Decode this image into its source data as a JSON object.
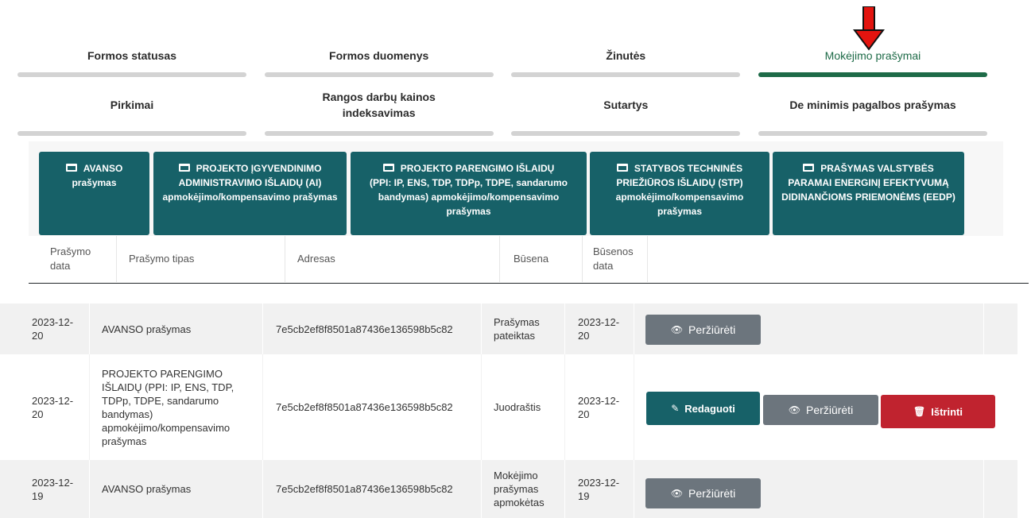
{
  "tabs_row1": [
    {
      "label": "Formos statusas"
    },
    {
      "label": "Formos duomenys"
    },
    {
      "label": "Žinutės"
    },
    {
      "label": "Mokėjimo prašymai"
    }
  ],
  "tabs_row2": [
    {
      "label": "Pirkimai"
    },
    {
      "label": "Rangos darbų kainos indeksavimas"
    },
    {
      "label": "Sutartys"
    },
    {
      "label": "De minimis pagalbos prašymas"
    }
  ],
  "active_tab": "Mokėjimo prašymai",
  "action_buttons": [
    {
      "title": "AVANSO",
      "subtitle": "prašymas"
    },
    {
      "title": "PROJEKTO ĮGYVENDINIMO",
      "subtitle": "ADMINISTRAVIMO IŠLAIDŲ (AI) apmokėjimo/kompensavimo prašymas"
    },
    {
      "title": "PROJEKTO PARENGIMO IŠLAIDŲ",
      "subtitle": "(PPI: IP, ENS, TDP, TDPp, TDPE, sandarumo bandymas) apmokėjimo/kompensavimo prašymas"
    },
    {
      "title": "STATYBOS TECHNINĖS",
      "subtitle": "PRIEŽIŪROS IŠLAIDŲ (STP) apmokėjimo/kompensavimo prašymas"
    },
    {
      "title": "PRAŠYMAS VALSTYBĖS",
      "subtitle": "PARAMAI ENERGINĮ EFEKTYVUMĄ DIDINANČIOMS PRIEMONĖMS (EEDP)"
    }
  ],
  "table": {
    "headers": {
      "date": "Prašymo data",
      "type": "Prašymo tipas",
      "address": "Adresas",
      "status": "Būsena",
      "status_date": "Būsenos data"
    },
    "rows": [
      {
        "date": "2023-12-20",
        "type": "AVANSO prašymas",
        "address": "7e5cb2ef8f8501a87436e136598b5c82",
        "status": "Prašymas pateiktas",
        "status_date": "2023-12-20",
        "buttons": [
          "view"
        ]
      },
      {
        "date": "2023-12-20",
        "type": "PROJEKTO PARENGIMO IŠLAIDŲ (PPI: IP, ENS, TDP, TDPp, TDPE, sandarumo bandymas) apmokėjimo/kompensavimo prašymas",
        "address": "7e5cb2ef8f8501a87436e136598b5c82",
        "status": "Juodraštis",
        "status_date": "2023-12-20",
        "buttons": [
          "edit",
          "view",
          "delete"
        ]
      },
      {
        "date": "2023-12-19",
        "type": "AVANSO prašymas",
        "address": "7e5cb2ef8f8501a87436e136598b5c82",
        "status": "Mokėjimo prašymas apmokėtas",
        "status_date": "2023-12-19",
        "buttons": [
          "view"
        ]
      }
    ]
  },
  "button_labels": {
    "view": "Peržiūrėti",
    "edit": "Redaguoti",
    "delete": "Ištrinti"
  },
  "colors": {
    "accent_green": "#1e6b48",
    "teal": "#176168",
    "grey_button": "#6c757d",
    "danger": "#c0232f",
    "annotation_arrow": "#e3140f"
  },
  "icons": {
    "view": "eye-icon",
    "edit": "pencil-icon",
    "delete": "trash-icon",
    "card": "credit-card-icon",
    "annotation": "red-arrow-down"
  }
}
